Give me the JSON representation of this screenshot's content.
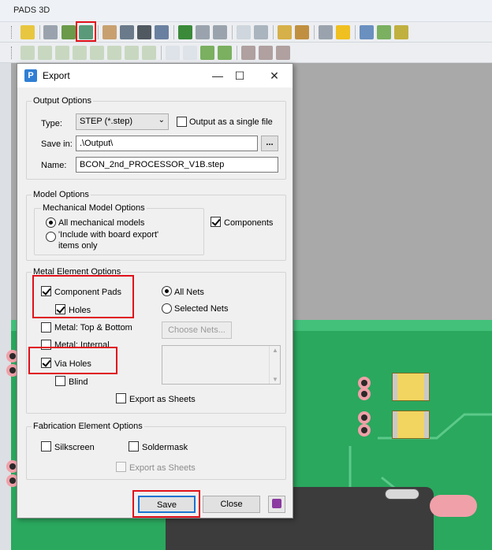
{
  "app": {
    "title": "PADS 3D"
  },
  "dialog": {
    "title": "Export",
    "window_controls": {
      "minimize": "—",
      "maximize": "☐",
      "close": "✕"
    },
    "output_options": {
      "group_label": "Output Options",
      "type_label": "Type:",
      "type_value": "STEP (*.step)",
      "single_file_label": "Output as a single file",
      "single_file_checked": false,
      "save_in_label": "Save in:",
      "save_in_value": ".\\Output\\",
      "browse_label": "...",
      "name_label": "Name:",
      "name_value": "BCON_2nd_PROCESSOR_V1B.step"
    },
    "model_options": {
      "group_label": "Model Options",
      "mech_group_label": "Mechanical Model Options",
      "all_mech_label": "All mechanical models",
      "include_label_1": "'Include with board export'",
      "include_label_2": "items only",
      "components_label": "Components",
      "components_checked": true
    },
    "metal_options": {
      "group_label": "Metal Element Options",
      "component_pads": "Component Pads",
      "holes": "Holes",
      "metal_top_bottom": "Metal: Top & Bottom",
      "metal_internal": "Metal: Internal",
      "via_holes": "Via Holes",
      "blind": "Blind",
      "all_nets": "All Nets",
      "selected_nets": "Selected Nets",
      "choose_nets": "Choose Nets...",
      "export_as_sheets": "Export as Sheets"
    },
    "fabrication_options": {
      "group_label": "Fabrication Element Options",
      "silkscreen": "Silkscreen",
      "soldermask": "Soldermask",
      "export_as_sheets": "Export as Sheets"
    },
    "buttons": {
      "save": "Save",
      "close": "Close"
    }
  },
  "colors": {
    "highlight": "#e0101a",
    "pcb": "#2aa85e",
    "accent": "#2f7fd4"
  }
}
